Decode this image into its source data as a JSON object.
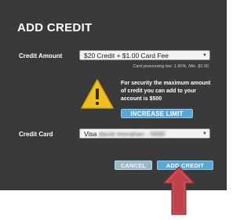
{
  "dialog": {
    "title": "ADD CREDIT",
    "credit_amount": {
      "label": "Credit Amount",
      "selected": "$20 Credit + $1.00 Card Fee",
      "fee_note": "Card processing fee: 1.90%, Min. $1.00"
    },
    "security": {
      "message": "For security the maximum amount of credit you can add to your account is $500",
      "increase_button": "INCREASE LIMIT"
    },
    "credit_card": {
      "label": "Credit Card",
      "selected_prefix": "Visa",
      "selected_obscured": "david monahan - 5690"
    },
    "buttons": {
      "cancel": "CANCEL",
      "add": "ADD CREDIT"
    }
  },
  "colors": {
    "dialog_bg": "#3a3a3a",
    "button_blue": "#5aa7d6",
    "warning_yellow": "#f0c020",
    "annotation_arrow": "#c0424a"
  },
  "icons": {
    "warning": "warning-triangle-icon",
    "dropdown": "chevron-down-icon",
    "annotation": "up-arrow-icon"
  }
}
